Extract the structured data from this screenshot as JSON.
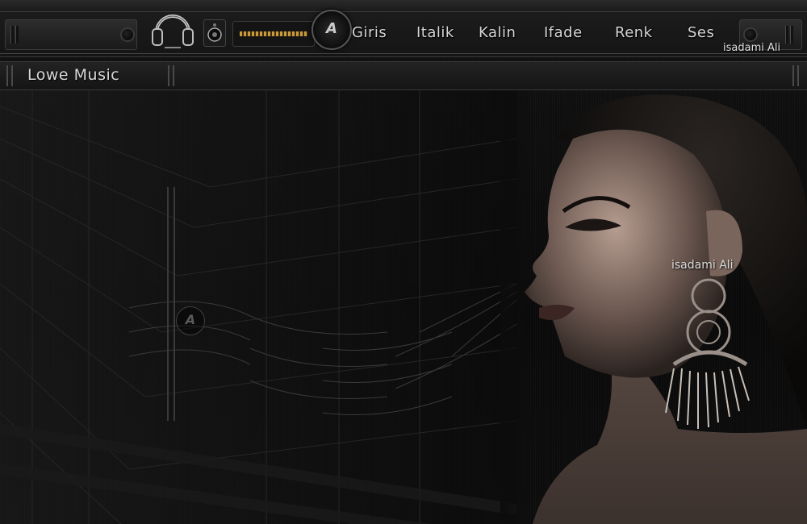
{
  "menu": {
    "items": [
      {
        "label": "Giris"
      },
      {
        "label": "Italik"
      },
      {
        "label": "Kalin"
      },
      {
        "label": "Ifade"
      },
      {
        "label": "Renk"
      },
      {
        "label": "Ses"
      }
    ]
  },
  "logo": {
    "letter": "A"
  },
  "header": {
    "site_title": "Lowe Music"
  },
  "signatures": {
    "top": "isadami Ali",
    "earring": "isadami Ali"
  },
  "icons": [
    "headphones-icon",
    "speaker-icon",
    "equalizer-icon",
    "logo-a-icon",
    "knob-icon"
  ],
  "colors": {
    "background": "#0c0c0c",
    "bar": "#1c1c1c",
    "text": "#d6d6d6",
    "eq_accent": "#c79a3a"
  },
  "watermark": {
    "letter": "A"
  }
}
